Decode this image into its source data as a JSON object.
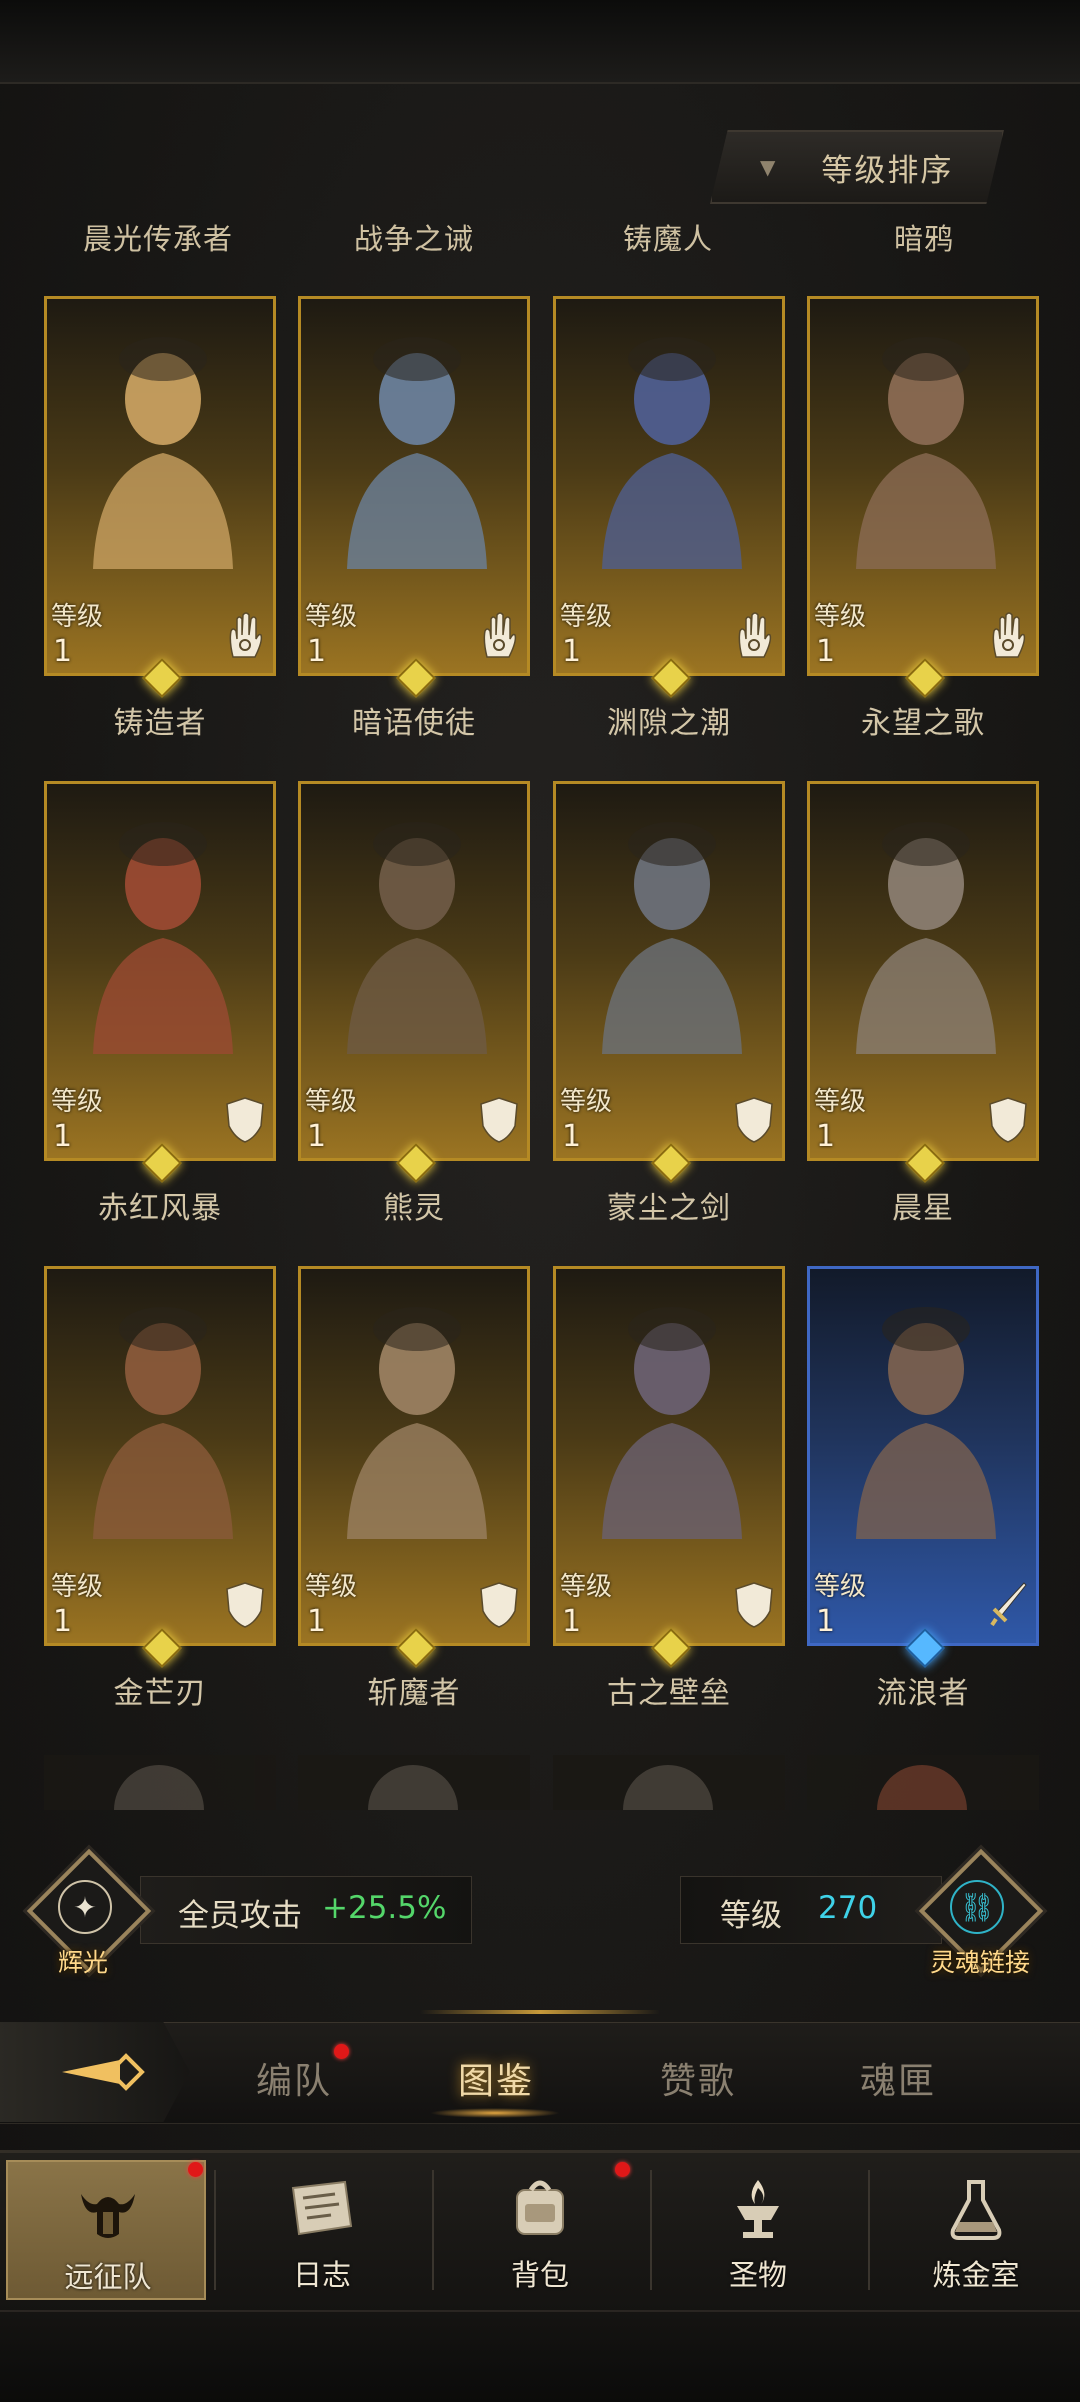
{
  "sort_button": {
    "label": "等级排序"
  },
  "top_names": [
    "晨光传承者",
    "战争之诫",
    "铸魔人",
    "暗鸦"
  ],
  "level_label": "等级",
  "heroes": [
    {
      "level": "1",
      "name": "铸造者",
      "frame": "gold",
      "class_icon": "hand-icon",
      "bg": "#c8a060"
    },
    {
      "level": "1",
      "name": "暗语使徒",
      "frame": "gold",
      "class_icon": "hand-icon",
      "bg": "#6a7f9a"
    },
    {
      "level": "1",
      "name": "渊隙之潮",
      "frame": "gold",
      "class_icon": "hand-icon",
      "bg": "#4f5e8f"
    },
    {
      "level": "1",
      "name": "永望之歌",
      "frame": "gold",
      "class_icon": "hand-icon",
      "bg": "#8a6a52"
    },
    {
      "level": "1",
      "name": "赤红风暴",
      "frame": "gold",
      "class_icon": "shield-icon",
      "bg": "#9a4a32"
    },
    {
      "level": "1",
      "name": "熊灵",
      "frame": "gold",
      "class_icon": "shield-icon",
      "bg": "#6e5a44"
    },
    {
      "level": "1",
      "name": "蒙尘之剑",
      "frame": "gold",
      "class_icon": "shield-icon",
      "bg": "#6c7078"
    },
    {
      "level": "1",
      "name": "晨星",
      "frame": "gold",
      "class_icon": "shield-icon",
      "bg": "#8a7d70"
    },
    {
      "level": "1",
      "name": "金芒刃",
      "frame": "gold",
      "class_icon": "shield-icon",
      "bg": "#8a5a3a"
    },
    {
      "level": "1",
      "name": "斩魔者",
      "frame": "gold",
      "class_icon": "shield-icon",
      "bg": "#9a8060"
    },
    {
      "level": "1",
      "name": "古之壁垒",
      "frame": "gold",
      "class_icon": "shield-icon",
      "bg": "#6a6070"
    },
    {
      "level": "1",
      "name": "流浪者",
      "frame": "blue",
      "class_icon": "sword-icon",
      "bg": "#7a6050"
    }
  ],
  "stats": {
    "left_emblem_label": "辉光",
    "attack_label": "全员攻击",
    "attack_value": "+25.5%",
    "level_label": "等级",
    "level_value": "270",
    "right_emblem_label": "灵魂链接"
  },
  "subtabs": [
    "编队",
    "图鉴",
    "赞歌",
    "魂匣"
  ],
  "active_subtab": "图鉴",
  "nav": [
    "远征队",
    "日志",
    "背包",
    "圣物",
    "炼金室"
  ],
  "active_nav": "远征队",
  "colors": {
    "gold_frame": "#b58a24",
    "blue_frame": "#3f68c4",
    "green": "#54d66a",
    "cyan": "#3fd2e8",
    "badge_red": "#e01818"
  }
}
